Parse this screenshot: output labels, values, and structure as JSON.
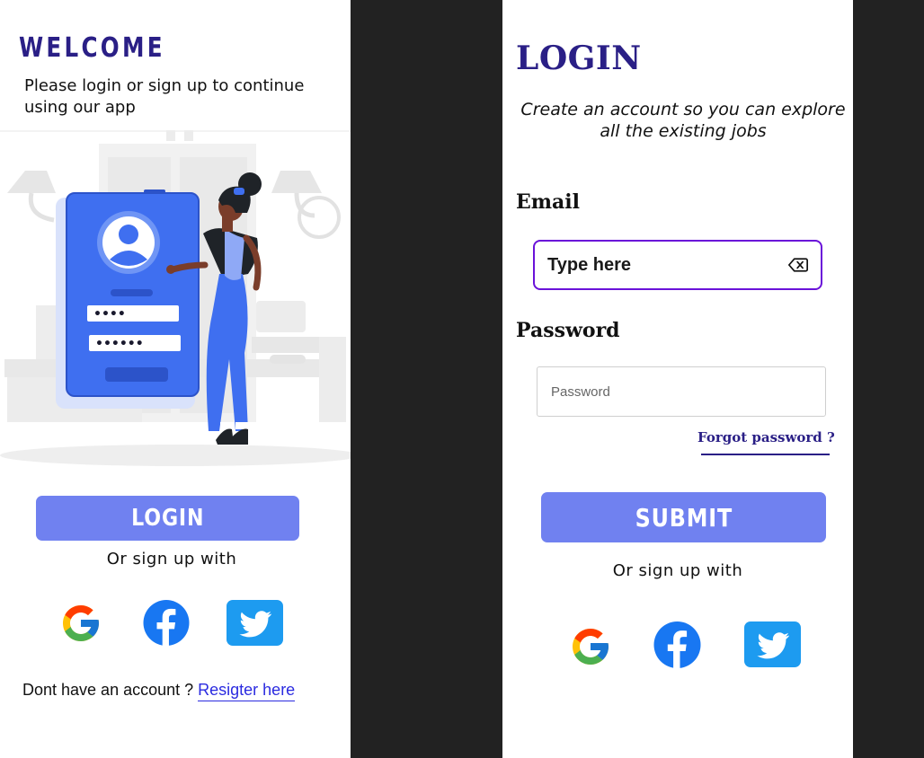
{
  "welcome": {
    "title": "WELCOME",
    "subtitle": "Please login or sign up to continue using our app",
    "login_button": "LOGIN",
    "or_text": "Or sign up with",
    "footer_text": "Dont have an account ? ",
    "footer_link": "Resigter here",
    "illustration": {
      "pin_mask": "••••",
      "password_mask": "••••••"
    }
  },
  "login": {
    "title": "LOGIN",
    "subtitle": "Create an account so you can explore all the existing jobs",
    "email_label": "Email",
    "email_placeholder": "Type here",
    "password_label": "Password",
    "password_placeholder": "Password",
    "forgot_password": "Forgot password ?",
    "submit_button": "SUBMIT",
    "or_text": "Or sign up with"
  },
  "social": [
    "google-icon",
    "facebook-icon",
    "twitter-icon"
  ],
  "colors": {
    "brand_dark": "#2a1f86",
    "button": "#7081f0",
    "illustration_blue": "#3f6ff0",
    "focus_border": "#6a12d9",
    "link": "#2b2be0",
    "divider": "#222222",
    "facebook": "#1877f2",
    "twitter": "#1d9bf0"
  }
}
